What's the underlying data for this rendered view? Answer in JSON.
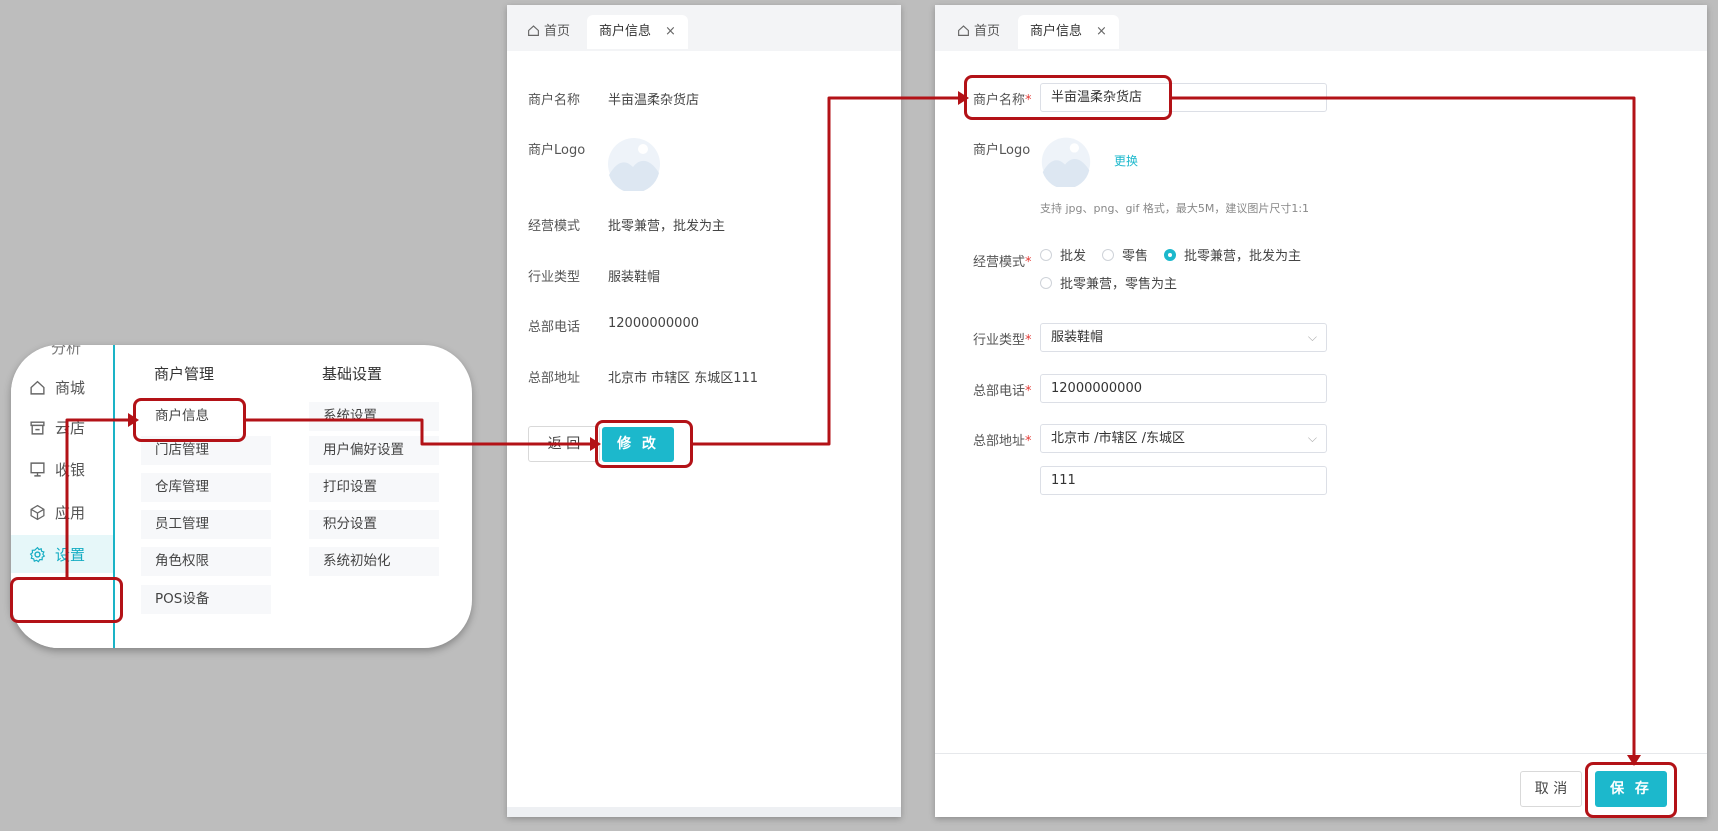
{
  "menu": {
    "partial_top": "分析",
    "sidebar": [
      {
        "label": "商城",
        "icon": "home-icon"
      },
      {
        "label": "云店",
        "icon": "store-icon"
      },
      {
        "label": "收银",
        "icon": "monitor-icon"
      },
      {
        "label": "应用",
        "icon": "cube-icon"
      },
      {
        "label": "设置",
        "icon": "gear-icon",
        "active": true
      }
    ],
    "groups": [
      {
        "title": "商户管理",
        "items": [
          "商户信息",
          "门店管理",
          "仓库管理",
          "员工管理",
          "角色权限",
          "POS设备"
        ]
      },
      {
        "title": "基础设置",
        "items": [
          "系统设置",
          "用户偏好设置",
          "打印设置",
          "积分设置",
          "系统初始化"
        ]
      }
    ]
  },
  "tabs": {
    "home": "首页",
    "current": "商户信息",
    "close": "×"
  },
  "detail": {
    "rows": [
      {
        "label": "商户名称",
        "value": "半亩温柔杂货店"
      },
      {
        "label": "商户Logo",
        "value": ""
      },
      {
        "label": "经营模式",
        "value": "批零兼营，批发为主"
      },
      {
        "label": "行业类型",
        "value": "服装鞋帽"
      },
      {
        "label": "总部电话",
        "value": "12000000000"
      },
      {
        "label": "总部地址",
        "value": "北京市 市辖区 东城区111"
      }
    ],
    "back_label": "返 回",
    "edit_label": "修 改"
  },
  "form": {
    "name_label": "商户名称",
    "name_value": "半亩温柔杂货店",
    "logo_label": "商户Logo",
    "replace_link": "更换",
    "logo_hint": "支持 jpg、png、gif 格式，最大5M，建议图片尺寸1:1",
    "mode_label": "经营模式",
    "mode_options": [
      "批发",
      "零售",
      "批零兼营，批发为主",
      "批零兼营，零售为主"
    ],
    "mode_selected": 2,
    "industry_label": "行业类型",
    "industry_value": "服装鞋帽",
    "phone_label": "总部电话",
    "phone_value": "12000000000",
    "address_label": "总部地址",
    "address_region": "北京市 /市辖区 /东城区",
    "address_detail": "111",
    "required_mark": "*",
    "cancel_label": "取 消",
    "save_label": "保 存"
  },
  "colors": {
    "accent": "#1cb8cc",
    "highlight": "#b31217",
    "bg": "#bdbdbd"
  }
}
